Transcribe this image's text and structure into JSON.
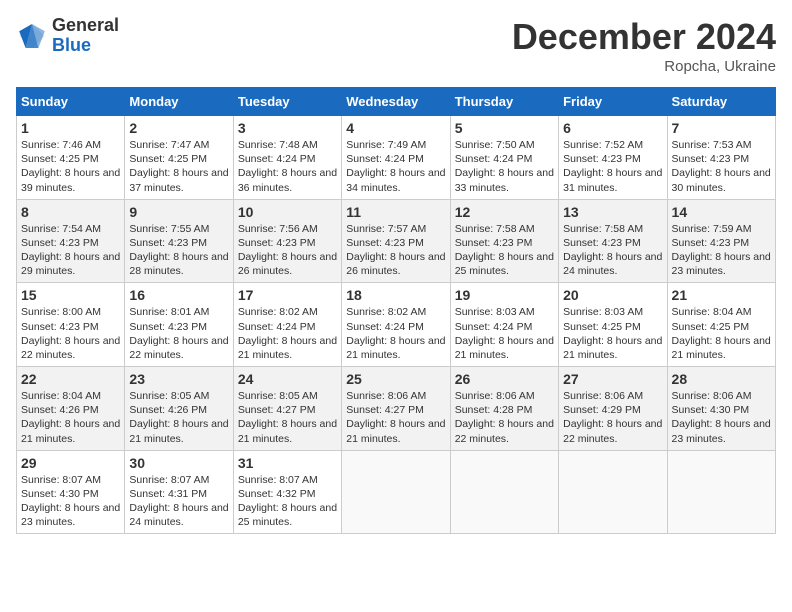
{
  "header": {
    "logo_general": "General",
    "logo_blue": "Blue",
    "month_title": "December 2024",
    "subtitle": "Ropcha, Ukraine"
  },
  "days_of_week": [
    "Sunday",
    "Monday",
    "Tuesday",
    "Wednesday",
    "Thursday",
    "Friday",
    "Saturday"
  ],
  "weeks": [
    [
      {
        "day": "1",
        "sunrise": "7:46 AM",
        "sunset": "4:25 PM",
        "daylight": "8 hours and 39 minutes."
      },
      {
        "day": "2",
        "sunrise": "7:47 AM",
        "sunset": "4:25 PM",
        "daylight": "8 hours and 37 minutes."
      },
      {
        "day": "3",
        "sunrise": "7:48 AM",
        "sunset": "4:24 PM",
        "daylight": "8 hours and 36 minutes."
      },
      {
        "day": "4",
        "sunrise": "7:49 AM",
        "sunset": "4:24 PM",
        "daylight": "8 hours and 34 minutes."
      },
      {
        "day": "5",
        "sunrise": "7:50 AM",
        "sunset": "4:24 PM",
        "daylight": "8 hours and 33 minutes."
      },
      {
        "day": "6",
        "sunrise": "7:52 AM",
        "sunset": "4:23 PM",
        "daylight": "8 hours and 31 minutes."
      },
      {
        "day": "7",
        "sunrise": "7:53 AM",
        "sunset": "4:23 PM",
        "daylight": "8 hours and 30 minutes."
      }
    ],
    [
      {
        "day": "8",
        "sunrise": "7:54 AM",
        "sunset": "4:23 PM",
        "daylight": "8 hours and 29 minutes."
      },
      {
        "day": "9",
        "sunrise": "7:55 AM",
        "sunset": "4:23 PM",
        "daylight": "8 hours and 28 minutes."
      },
      {
        "day": "10",
        "sunrise": "7:56 AM",
        "sunset": "4:23 PM",
        "daylight": "8 hours and 26 minutes."
      },
      {
        "day": "11",
        "sunrise": "7:57 AM",
        "sunset": "4:23 PM",
        "daylight": "8 hours and 26 minutes."
      },
      {
        "day": "12",
        "sunrise": "7:58 AM",
        "sunset": "4:23 PM",
        "daylight": "8 hours and 25 minutes."
      },
      {
        "day": "13",
        "sunrise": "7:58 AM",
        "sunset": "4:23 PM",
        "daylight": "8 hours and 24 minutes."
      },
      {
        "day": "14",
        "sunrise": "7:59 AM",
        "sunset": "4:23 PM",
        "daylight": "8 hours and 23 minutes."
      }
    ],
    [
      {
        "day": "15",
        "sunrise": "8:00 AM",
        "sunset": "4:23 PM",
        "daylight": "8 hours and 22 minutes."
      },
      {
        "day": "16",
        "sunrise": "8:01 AM",
        "sunset": "4:23 PM",
        "daylight": "8 hours and 22 minutes."
      },
      {
        "day": "17",
        "sunrise": "8:02 AM",
        "sunset": "4:24 PM",
        "daylight": "8 hours and 21 minutes."
      },
      {
        "day": "18",
        "sunrise": "8:02 AM",
        "sunset": "4:24 PM",
        "daylight": "8 hours and 21 minutes."
      },
      {
        "day": "19",
        "sunrise": "8:03 AM",
        "sunset": "4:24 PM",
        "daylight": "8 hours and 21 minutes."
      },
      {
        "day": "20",
        "sunrise": "8:03 AM",
        "sunset": "4:25 PM",
        "daylight": "8 hours and 21 minutes."
      },
      {
        "day": "21",
        "sunrise": "8:04 AM",
        "sunset": "4:25 PM",
        "daylight": "8 hours and 21 minutes."
      }
    ],
    [
      {
        "day": "22",
        "sunrise": "8:04 AM",
        "sunset": "4:26 PM",
        "daylight": "8 hours and 21 minutes."
      },
      {
        "day": "23",
        "sunrise": "8:05 AM",
        "sunset": "4:26 PM",
        "daylight": "8 hours and 21 minutes."
      },
      {
        "day": "24",
        "sunrise": "8:05 AM",
        "sunset": "4:27 PM",
        "daylight": "8 hours and 21 minutes."
      },
      {
        "day": "25",
        "sunrise": "8:06 AM",
        "sunset": "4:27 PM",
        "daylight": "8 hours and 21 minutes."
      },
      {
        "day": "26",
        "sunrise": "8:06 AM",
        "sunset": "4:28 PM",
        "daylight": "8 hours and 22 minutes."
      },
      {
        "day": "27",
        "sunrise": "8:06 AM",
        "sunset": "4:29 PM",
        "daylight": "8 hours and 22 minutes."
      },
      {
        "day": "28",
        "sunrise": "8:06 AM",
        "sunset": "4:30 PM",
        "daylight": "8 hours and 23 minutes."
      }
    ],
    [
      {
        "day": "29",
        "sunrise": "8:07 AM",
        "sunset": "4:30 PM",
        "daylight": "8 hours and 23 minutes."
      },
      {
        "day": "30",
        "sunrise": "8:07 AM",
        "sunset": "4:31 PM",
        "daylight": "8 hours and 24 minutes."
      },
      {
        "day": "31",
        "sunrise": "8:07 AM",
        "sunset": "4:32 PM",
        "daylight": "8 hours and 25 minutes."
      },
      null,
      null,
      null,
      null
    ]
  ],
  "labels": {
    "sunrise": "Sunrise:",
    "sunset": "Sunset:",
    "daylight": "Daylight:"
  }
}
